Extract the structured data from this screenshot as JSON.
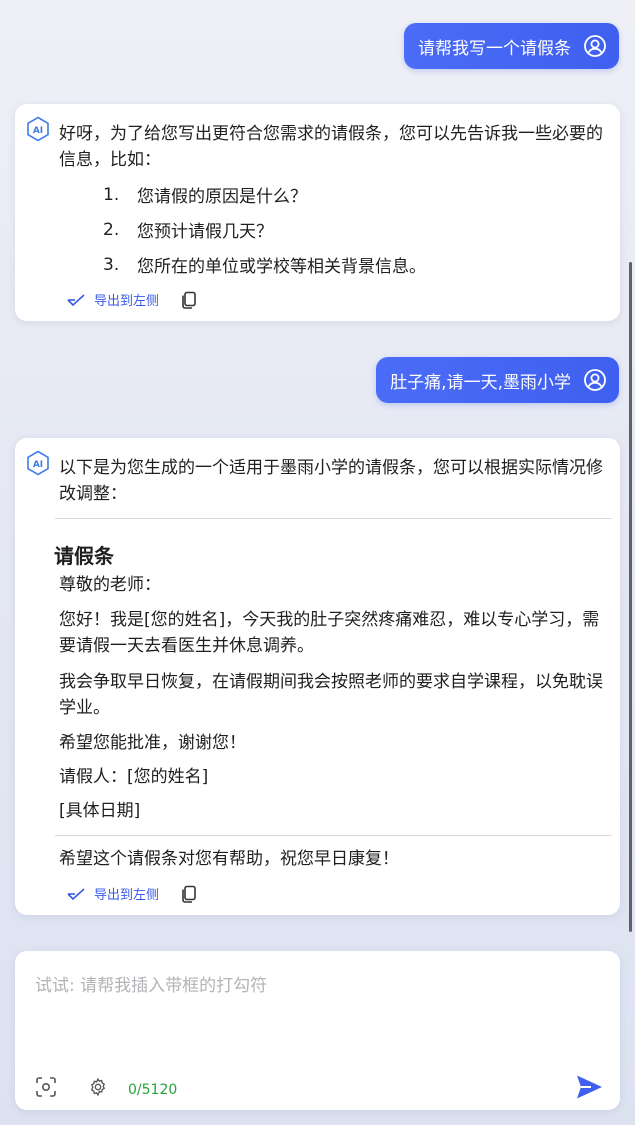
{
  "conversation": {
    "msg1_user": "请帮我写一个请假条",
    "msg2_ai": {
      "intro": "好呀，为了给您写出更符合您需求的请假条，您可以先告诉我一些必要的信息，比如：",
      "list": [
        {
          "num": "1.",
          "text": "您请假的原因是什么？"
        },
        {
          "num": "2.",
          "text": "您预计请假几天？"
        },
        {
          "num": "3.",
          "text": "您所在的单位或学校等相关背景信息。"
        }
      ],
      "export_label": "导出到左侧"
    },
    "msg3_user": "肚子痛,请一天,墨雨小学",
    "msg4_ai": {
      "intro": "以下是为您生成的一个适用于墨雨小学的请假条，您可以根据实际情况修改调整：",
      "letter_title": "请假条",
      "salutation": "尊敬的老师：",
      "p1": "您好！我是[您的姓名]，今天我的肚子突然疼痛难忍，难以专心学习，需要请假一天去看医生并休息调养。",
      "p2": "我会争取早日恢复，在请假期间我会按照老师的要求自学课程，以免耽误学业。",
      "p3": "希望您能批准，谢谢您！",
      "signer": "请假人：[您的姓名]",
      "date": "[具体日期]",
      "closing": "希望这个请假条对您有帮助，祝您早日康复！",
      "export_label": "导出到左侧"
    }
  },
  "input": {
    "placeholder": "试试: 请帮我插入带框的打勾符",
    "char_count": "0/5120"
  },
  "icons": {
    "user": "user-circle-icon",
    "ai": "ai-hexagon-icon",
    "export": "export-arrow-icon",
    "copy": "copy-icon",
    "screenshot": "screenshot-icon",
    "settings": "gear-icon",
    "send": "send-icon"
  },
  "colors": {
    "accent": "#3f5ff0",
    "count_green": "#26a33a",
    "placeholder": "#b3b3b8"
  }
}
